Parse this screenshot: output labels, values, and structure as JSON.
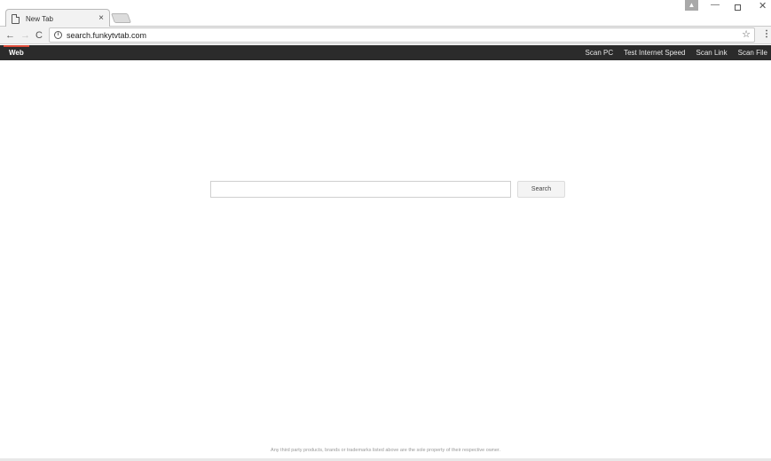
{
  "browser": {
    "tab": {
      "title": "New Tab",
      "close_glyph": "×",
      "icon": "page-icon"
    },
    "window_controls": {
      "minimize": "—",
      "maximize": "",
      "close": "✕"
    },
    "toolbar": {
      "back_glyph": "←",
      "forward_glyph": "→",
      "reload_glyph": "C",
      "url": "search.funkytvtab.com",
      "info_glyph": "i",
      "star_glyph": "☆",
      "menu_glyph": "⋮"
    }
  },
  "site_nav": {
    "active_tab": "Web",
    "links": [
      "Scan PC",
      "Test Internet Speed",
      "Scan Link",
      "Scan File"
    ]
  },
  "search": {
    "input_value": "",
    "button_label": "Search"
  },
  "footer": {
    "disclaimer": "Any third party products, brands or trademarks listed above are the sole property of their respective owner."
  },
  "colors": {
    "nav_bar": "#2b2b2b",
    "active_tab_accent": "#dd4b39",
    "page_background": "#ffffff"
  }
}
